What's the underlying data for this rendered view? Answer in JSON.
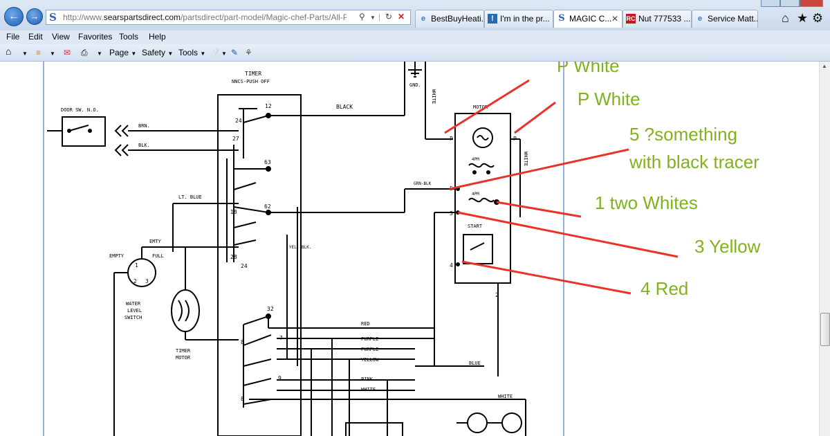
{
  "browser": {
    "url_prefix": "http://www.",
    "url_domain": "searspartsdirect.com",
    "url_rest": "/partsdirect/part-model/Magic-chef-Parts/All-Produ",
    "tabs": [
      {
        "label": "BestBuyHeati...",
        "icon": "ie-icon"
      },
      {
        "label": "I'm in the pr...",
        "icon": "forum-icon"
      },
      {
        "label": "MAGIC C...",
        "icon": "sears-icon",
        "active": true
      },
      {
        "label": "Nut 777533 ...",
        "icon": "rc-icon"
      },
      {
        "label": "Service Matt...",
        "icon": "ie-icon"
      }
    ],
    "menu": [
      "File",
      "Edit",
      "View",
      "Favorites",
      "Tools",
      "Help"
    ],
    "commands": {
      "page": "Page",
      "safety": "Safety",
      "tools": "Tools"
    }
  },
  "diagram": {
    "timer_title": "TIMER",
    "timer_subtitle": "NNCS-PUSH OFF",
    "door_switch": "DOOR SW. N.O.",
    "water_level_switch": "WATER LEVEL SWITCH",
    "timer_motor": "TIMER MOTOR",
    "motor": "MOTOR",
    "start": "START",
    "ground": "GND.",
    "labels": {
      "black": "BLACK",
      "brn": "BRN.",
      "blk": "BLK.",
      "lt_blue": "LT. BLUE",
      "empty": "EMPTY",
      "full": "FULL",
      "emty": "EMTY",
      "grn_blk": "GRN-BLK",
      "yel_blk": "YEL.-BLK.",
      "red": "RED",
      "purple": "PURPLE",
      "yellow": "YELLOW",
      "pink": "PINK",
      "white": "WHITE",
      "blue": "BLUE",
      "four_pm": "4PM"
    }
  },
  "annotations": {
    "p_white_1": "P White",
    "p_white_2": "P White",
    "five_line1": "5 ?something",
    "five_line2": "with black tracer",
    "one_whites": "1 two Whites",
    "three_yellow": "3 Yellow",
    "four_red": "4 Red"
  },
  "colors": {
    "annotation_text": "#7fb21b",
    "annotation_line": "#e8322a",
    "page_guide": "#8fb0e0"
  }
}
